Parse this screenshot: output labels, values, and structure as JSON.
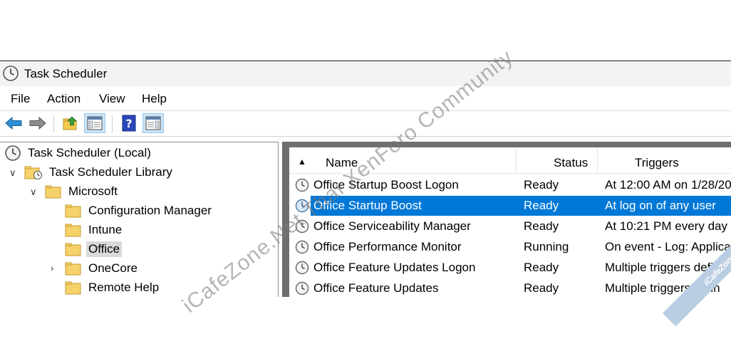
{
  "window": {
    "title": "Task Scheduler"
  },
  "menu": {
    "items": [
      "File",
      "Action",
      "View",
      "Help"
    ]
  },
  "toolbar": {
    "buttons": [
      "back-icon",
      "forward-icon",
      "up-folder-icon",
      "show-hide-console-tree-icon",
      "help-icon",
      "show-hide-action-pane-icon"
    ]
  },
  "tree": {
    "root": "Task Scheduler (Local)",
    "library": "Task Scheduler Library",
    "microsoft": "Microsoft",
    "children": [
      "Configuration Manager",
      "Intune",
      "Office",
      "OneCore",
      "Remote Help"
    ],
    "selected": "Office"
  },
  "list": {
    "columns": [
      "Name",
      "Status",
      "Triggers"
    ],
    "rows": [
      {
        "name": "Office Startup Boost Logon",
        "status": "Ready",
        "triggers": "At 12:00 AM on 1/28/20"
      },
      {
        "name": "Office Startup Boost",
        "status": "Ready",
        "triggers": "At log on of any user"
      },
      {
        "name": "Office Serviceability Manager",
        "status": "Ready",
        "triggers": "At 10:21 PM every day -"
      },
      {
        "name": "Office Performance Monitor",
        "status": "Running",
        "triggers": "On event - Log: Applica"
      },
      {
        "name": "Office Feature Updates Logon",
        "status": "Ready",
        "triggers": "Multiple triggers defin"
      },
      {
        "name": "Office Feature Updates",
        "status": "Ready",
        "triggers": "Multiple triggers defin"
      }
    ],
    "selected_row": "Office Startup Boost"
  },
  "watermark": {
    "text": "iCafeZone.Net Thai XenForo Community",
    "corner": "iCafeZone"
  },
  "colors": {
    "selection": "#0078d7",
    "tree_selection": "#d9d9d9",
    "frame": "#6f6f6f"
  }
}
